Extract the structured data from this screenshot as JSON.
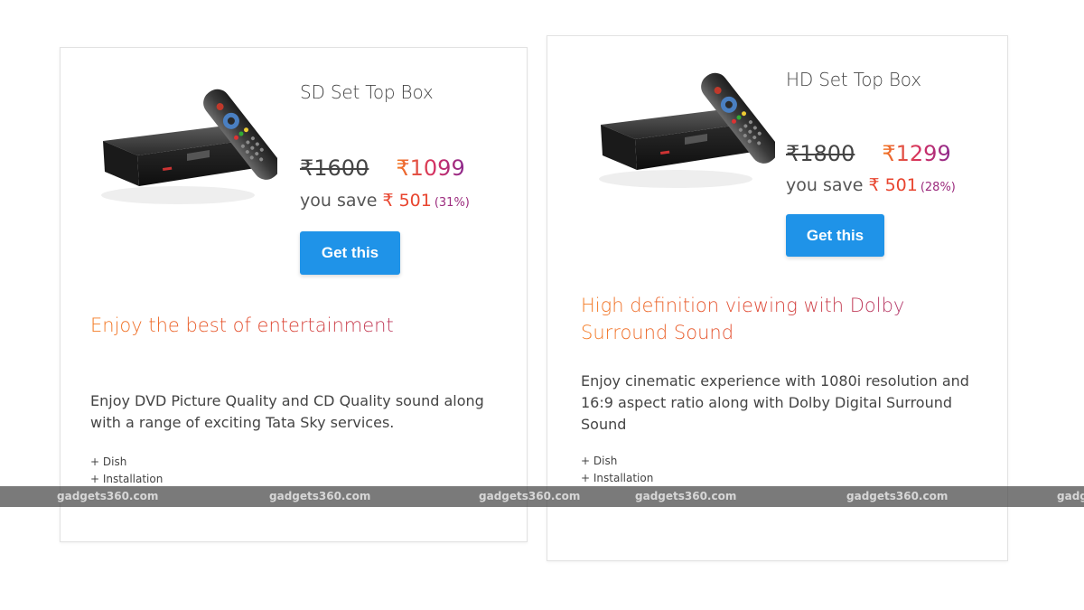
{
  "cards": [
    {
      "title": "SD Set Top Box",
      "old_price": "₹1600",
      "new_price": "₹1099",
      "save_label": "you save",
      "save_amount": "₹ 501",
      "save_percent": "(31%)",
      "button_label": "Get this",
      "headline": "Enjoy the best of entertainment",
      "description": "Enjoy DVD Picture Quality and CD Quality sound along with a range of exciting Tata Sky services.",
      "extras": [
        "+ Dish",
        "+ Installation"
      ]
    },
    {
      "title": "HD Set Top Box",
      "old_price": "₹1800",
      "new_price": "₹1299",
      "save_label": "you save",
      "save_amount": "₹ 501",
      "save_percent": "(28%)",
      "button_label": "Get this",
      "headline": "High definition viewing with Dolby Surround Sound",
      "description": "Enjoy cinematic experience with 1080i resolution and 16:9 aspect ratio along with Dolby Digital Surround Sound",
      "extras": [
        "+ Dish",
        "+ Installation"
      ]
    }
  ],
  "watermark": {
    "labels": [
      "gadgets360.com",
      "gadgets360.com",
      "gadgets360.com",
      "gadgets360.com",
      "gadgets360.com",
      "gadg"
    ]
  },
  "colors": {
    "button": "#1f93e8",
    "price_gradient_start": "#f47a20",
    "price_gradient_end": "#8a2a8f",
    "save_amount": "#e8452f"
  },
  "icons": {
    "product": "set-top-box-with-remote"
  }
}
